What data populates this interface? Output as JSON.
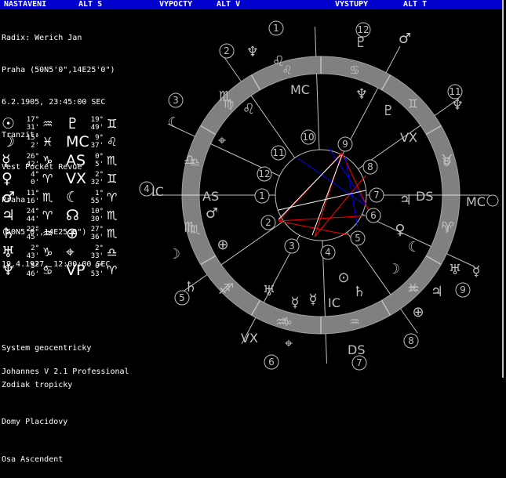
{
  "menu": {
    "nastaveni": "NASTAVENI",
    "alt_s": "ALT S",
    "vypocty": "VYPOCTY",
    "alt_v": "ALT V",
    "vystupy": "VYSTUPY",
    "alt_t": "ALT T"
  },
  "info": {
    "radix": "Radix: Werich Jan",
    "radix_place": "Praha (50N5'0\",14E25'0\")",
    "radix_date": "6.2.1905, 23:45:00 SEC",
    "tranzit": "Tranzit:",
    "tranzit_name": "Vest Pocket Revue",
    "tranzit_city": "Praha",
    "tranzit_coords": "(50N5'0\",14E25'0\")",
    "tranzit_date": "19.4.1927, 12:00:00 SEC"
  },
  "planets": [
    {
      "glyph": "☉",
      "deg": "17°",
      "min": "31'",
      "sign": "♒"
    },
    {
      "glyph": "♇",
      "deg": "19°",
      "min": "49'",
      "sign": "♊"
    },
    {
      "glyph": "☽",
      "deg": "15°",
      "min": "2'",
      "sign": "♓"
    },
    {
      "glyph": "MC",
      "deg": "9°",
      "min": "37'",
      "sign": "♌"
    },
    {
      "glyph": "☿",
      "deg": "26°",
      "min": "42'",
      "sign": "♑"
    },
    {
      "glyph": "AS",
      "deg": "0°",
      "min": "5'",
      "sign": "♏"
    },
    {
      "glyph": "♀",
      "deg": "4°",
      "min": "0'",
      "sign": "♈"
    },
    {
      "glyph": "VX",
      "deg": "2°",
      "min": "32'",
      "sign": "♊"
    },
    {
      "glyph": "♂",
      "deg": "11°",
      "min": "16'",
      "sign": "♏"
    },
    {
      "glyph": "☾",
      "deg": "1°",
      "min": "55'",
      "sign": "♈"
    },
    {
      "glyph": "♃",
      "deg": "24°",
      "min": "44'",
      "sign": "♈"
    },
    {
      "glyph": "☊",
      "deg": "10°",
      "min": "30'",
      "sign": "♏"
    },
    {
      "glyph": "♄",
      "deg": "22°",
      "min": "45'",
      "sign": "♒"
    },
    {
      "glyph": "⊕",
      "deg": "27°",
      "min": "36'",
      "sign": "♏"
    },
    {
      "glyph": "♅",
      "deg": "2°",
      "min": "43'",
      "sign": "♑"
    },
    {
      "glyph": "⌖",
      "deg": "2°",
      "min": "33'",
      "sign": "♎"
    },
    {
      "glyph": "♆",
      "deg": "5°",
      "min": "46'",
      "sign": "♋"
    },
    {
      "glyph": "VP",
      "deg": "0°",
      "min": "53'",
      "sign": "♈"
    }
  ],
  "settings": {
    "system": "System geocentricky",
    "zodiak": "Zodiak tropicky",
    "domy": "Domy Placidovy",
    "osa": "Osa Ascendent"
  },
  "footer": "Johannes V 2.1 Professional",
  "wheel": {
    "angles": {
      "as": "AS",
      "ds": "DS",
      "mc": "MC",
      "ic": "IC",
      "mc_outer": "MC",
      "ic_outer": "IC",
      "vx": "VX",
      "vx_outer": "VX",
      "ds_outer": "DS"
    },
    "inner_houses": [
      "1",
      "2",
      "3",
      "4",
      "5",
      "6",
      "7",
      "8",
      "9",
      "10",
      "11",
      "12"
    ],
    "outer_houses": [
      "1",
      "2",
      "3",
      "4",
      "5",
      "6",
      "7",
      "8",
      "9",
      "10",
      "11",
      "12"
    ],
    "colors": {
      "ring": "#808080",
      "line": "#c0c0c0",
      "blue": "#0000ff",
      "red": "#ff0000",
      "white": "#ffffff"
    }
  }
}
